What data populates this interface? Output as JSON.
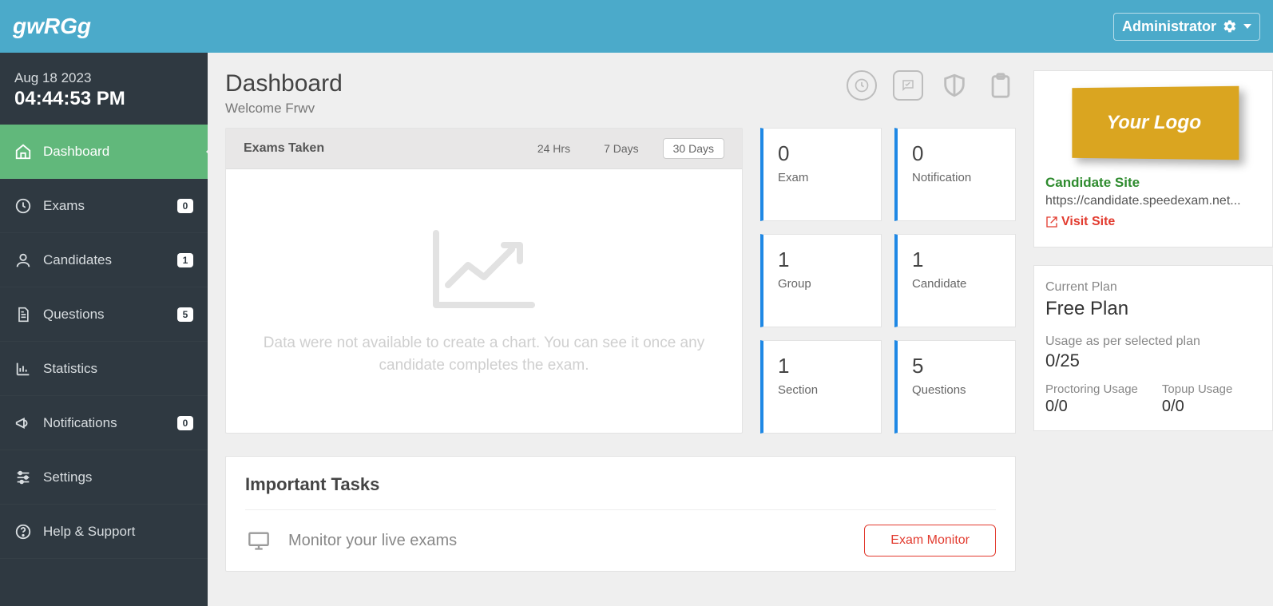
{
  "header": {
    "brand": "gwRGg",
    "user_label": "Administrator"
  },
  "sidebar": {
    "date": "Aug 18 2023",
    "time": "04:44:53 PM",
    "items": [
      {
        "label": "Dashboard",
        "badge": null,
        "active": true
      },
      {
        "label": "Exams",
        "badge": "0",
        "active": false
      },
      {
        "label": "Candidates",
        "badge": "1",
        "active": false
      },
      {
        "label": "Questions",
        "badge": "5",
        "active": false
      },
      {
        "label": "Statistics",
        "badge": null,
        "active": false
      },
      {
        "label": "Notifications",
        "badge": "0",
        "active": false
      },
      {
        "label": "Settings",
        "badge": null,
        "active": false
      },
      {
        "label": "Help & Support",
        "badge": null,
        "active": false
      }
    ]
  },
  "page": {
    "title": "Dashboard",
    "welcome": "Welcome Frwv"
  },
  "chart": {
    "title": "Exams Taken",
    "ranges": {
      "r1": "24 Hrs",
      "r2": "7 Days",
      "r3": "30 Days"
    },
    "empty_msg": "Data were not available to create a chart. You can see it once any candidate completes the exam."
  },
  "stats": [
    {
      "value": "0",
      "label": "Exam"
    },
    {
      "value": "0",
      "label": "Notification"
    },
    {
      "value": "1",
      "label": "Group"
    },
    {
      "value": "1",
      "label": "Candidate"
    },
    {
      "value": "1",
      "label": "Section"
    },
    {
      "value": "5",
      "label": "Questions"
    }
  ],
  "logo": {
    "text": "Your Logo",
    "site_title": "Candidate Site",
    "site_url": "https://candidate.speedexam.net...",
    "visit": "Visit Site"
  },
  "plan": {
    "label": "Current Plan",
    "name": "Free Plan",
    "usage_label": "Usage as per selected plan",
    "usage_value": "0/25",
    "proctoring_label": "Proctoring Usage",
    "proctoring_value": "0/0",
    "topup_label": "Topup Usage",
    "topup_value": "0/0"
  },
  "tasks": {
    "title": "Important Tasks",
    "row1_label": "Monitor your live exams",
    "row1_button": "Exam Monitor"
  }
}
